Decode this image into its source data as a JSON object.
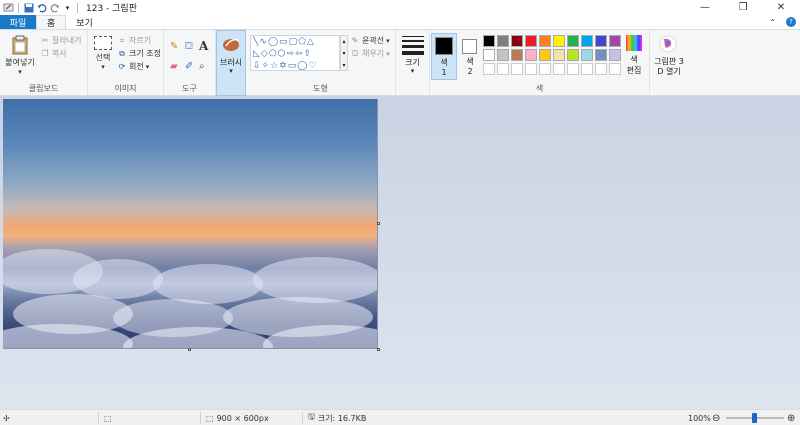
{
  "titlebar": {
    "title": "123 - 그림판",
    "minimize_icon": "minimize-icon",
    "maximize_icon": "restore-icon",
    "close_icon": "close-icon"
  },
  "tabs": {
    "file": "파일",
    "home": "홈",
    "view": "보기"
  },
  "clipboard": {
    "paste": "붙여넣기",
    "cut": "잘라내기",
    "copy": "복사",
    "label": "클립보드"
  },
  "image": {
    "select": "선택",
    "crop": "자르기",
    "resize": "크기 조정",
    "rotate": "회전",
    "label": "이미지"
  },
  "tools": {
    "label": "도구"
  },
  "brushes": {
    "label": "브러시"
  },
  "shapes": {
    "outline": "윤곽선",
    "fill": "채우기",
    "label": "도형"
  },
  "size": {
    "label": "크기"
  },
  "colors": {
    "color1": "색\n1",
    "color1_a": "색",
    "color1_b": "1",
    "color2_a": "색",
    "color2_b": "2",
    "edit_a": "색",
    "edit_b": "편집",
    "paint3d_a": "그림판 3",
    "paint3d_b": "D 열기",
    "label": "색",
    "palette_row1": [
      "#000000",
      "#7f7f7f",
      "#880015",
      "#ed1c24",
      "#ff7f27",
      "#fff200",
      "#22b14c",
      "#00a2e8",
      "#3f48cc",
      "#a349a4"
    ],
    "palette_row2": [
      "#ffffff",
      "#c3c3c3",
      "#b97a57",
      "#ffaec9",
      "#ffc90e",
      "#efe4b0",
      "#b5e61d",
      "#99d9ea",
      "#7092be",
      "#c8bfe7"
    ]
  },
  "status": {
    "dimensions": "900 × 600px",
    "filesize": "크기: 16.7KB",
    "zoom": "100%"
  }
}
